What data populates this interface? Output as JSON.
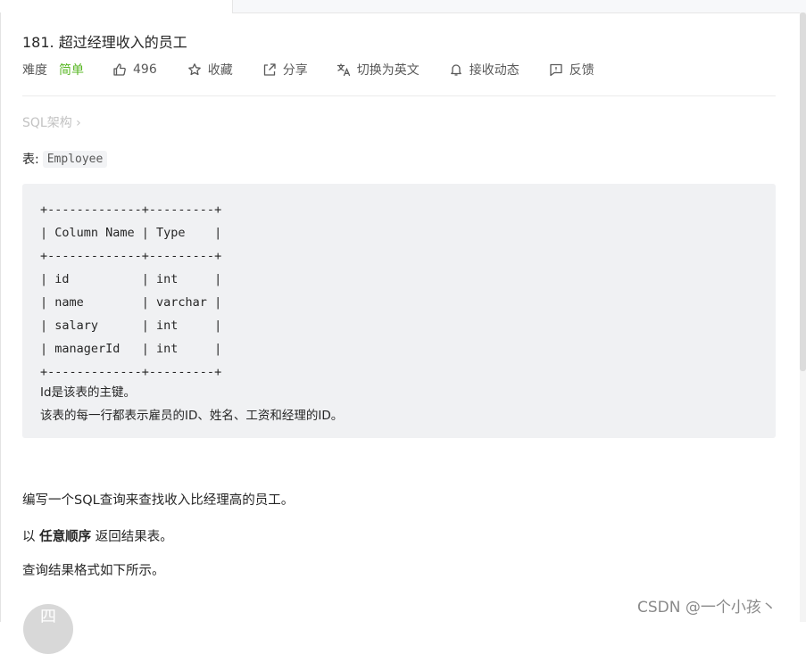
{
  "problem": {
    "title": "181. 超过经理收入的员工",
    "difficulty_label": "难度",
    "difficulty_value": "简单",
    "likes": "496",
    "favorite_label": "收藏",
    "share_label": "分享",
    "translate_label": "切换为英文",
    "subscribe_label": "接收动态",
    "feedback_label": "反馈"
  },
  "breadcrumb": {
    "schema_label": "SQL架构",
    "chevron": "›"
  },
  "table_intro": {
    "label": "表:",
    "table_name": "Employee"
  },
  "schema_block": {
    "ascii_table": "+-------------+---------+\n| Column Name | Type    |\n+-------------+---------+\n| id          | int     |\n| name        | varchar |\n| salary      | int     |\n| managerId   | int     |\n+-------------+---------+",
    "note1": "Id是该表的主键。",
    "note2": "该表的每一行都表示雇员的ID、姓名、工资和经理的ID。"
  },
  "description": {
    "line1": "编写一个SQL查询来查找收入比经理高的员工。",
    "line2_prefix": "以 ",
    "line2_bold": "任意顺序",
    "line2_suffix": " 返回结果表。",
    "line3": "查询结果格式如下所示。"
  },
  "watermark": "CSDN @一个小孩丶",
  "avatar_text": "四",
  "icons": {
    "like": "thumbs-up-icon",
    "favorite": "star-icon",
    "share": "share-icon",
    "translate": "translate-icon",
    "subscribe": "bell-icon",
    "feedback": "feedback-icon"
  }
}
